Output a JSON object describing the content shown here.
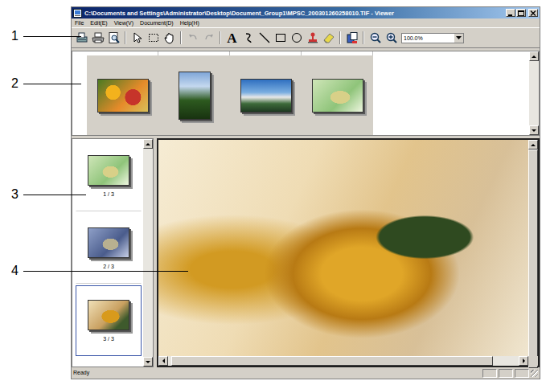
{
  "window": {
    "title": "C:\\Documents and Settings\\Administrator\\Desktop\\Document_Group1\\MPSC_200301260258010.TIF - Viewer"
  },
  "menu": [
    "File",
    "Edit(E)",
    "View(V)",
    "Document(D)",
    "Help(H)"
  ],
  "toolbar": {
    "undo": {
      "disabled": true
    },
    "redo": {
      "disabled": true
    },
    "text_tool": "A",
    "zoom": "100.0%"
  },
  "callouts": [
    "1",
    "2",
    "3",
    "4"
  ],
  "documents": [
    {
      "kind": "landscape"
    },
    {
      "kind": "portrait"
    },
    {
      "kind": "landscape"
    },
    {
      "kind": "landscape"
    }
  ],
  "pages": [
    {
      "label": "1 / 3",
      "selected": false
    },
    {
      "label": "2 / 3",
      "selected": false
    },
    {
      "label": "3 / 3",
      "selected": true
    }
  ],
  "status_bar": {
    "text": "Ready"
  }
}
